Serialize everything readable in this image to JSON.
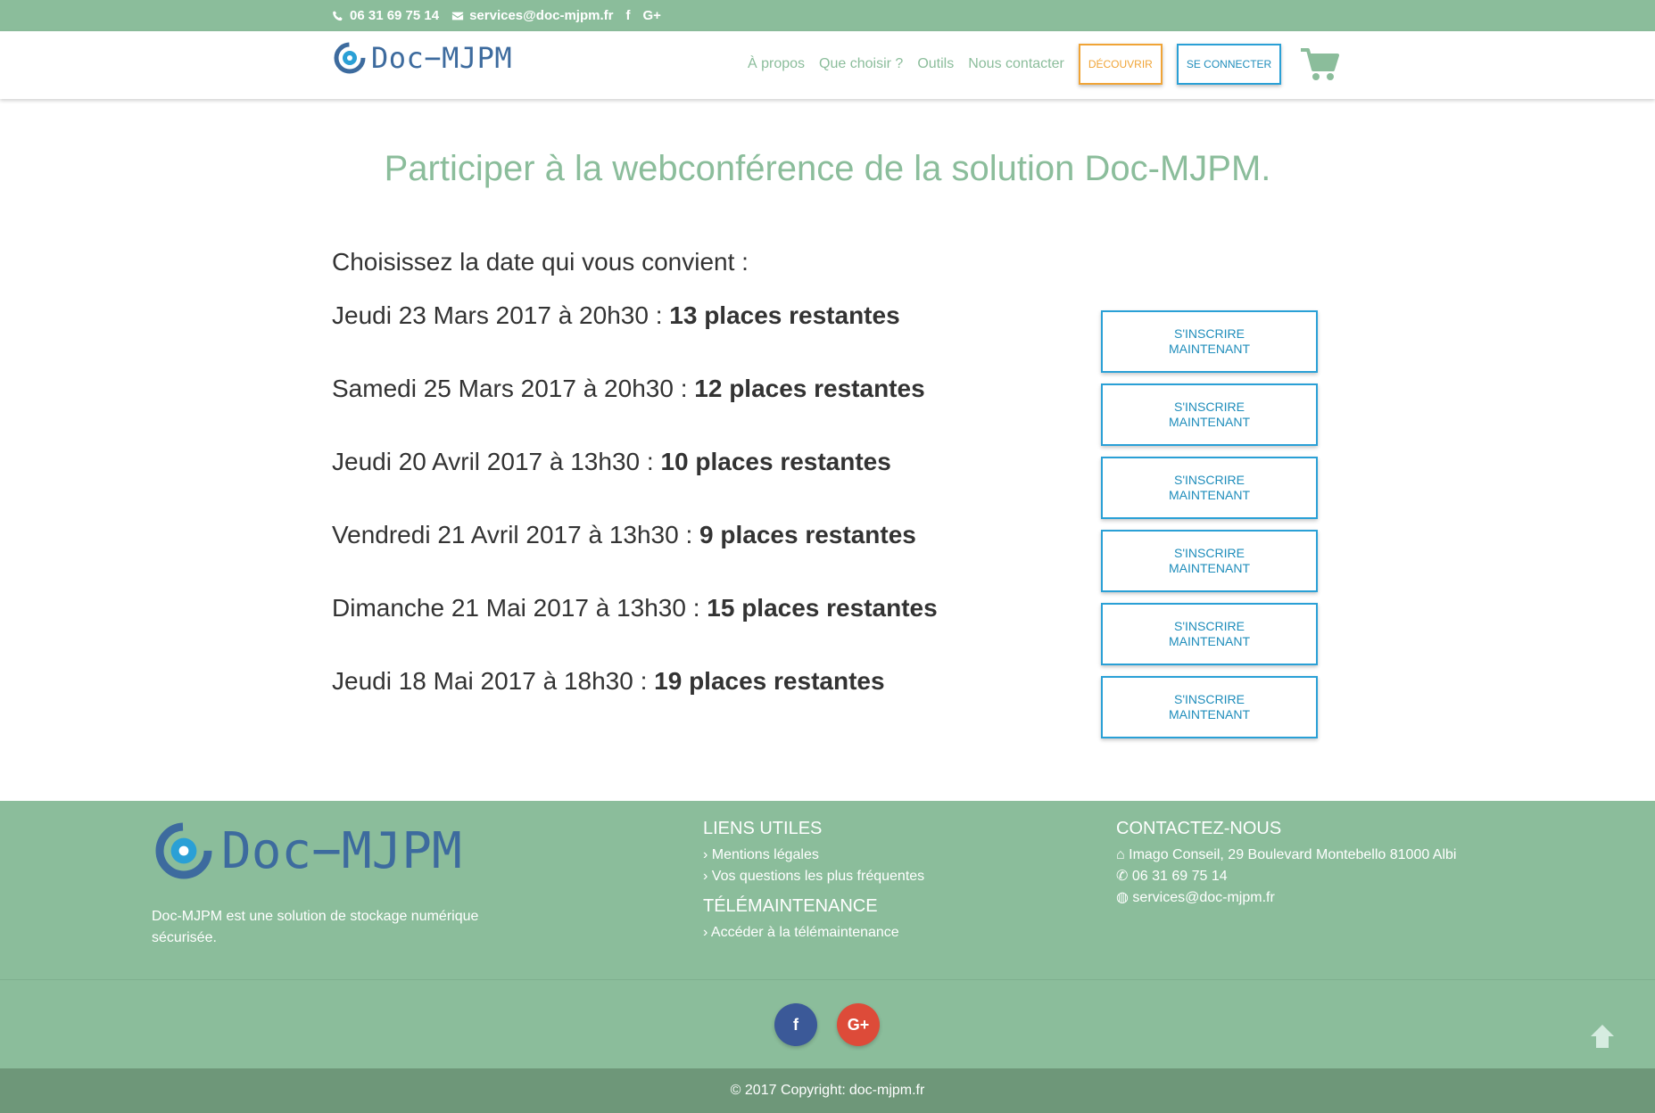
{
  "topbar": {
    "phone": "06 31 69 75 14",
    "email": "services@doc-mjpm.fr",
    "facebook_glyph": "f",
    "googleplus_glyph": "G+"
  },
  "header": {
    "logo_text": "Doc−MJPM",
    "nav": [
      {
        "label": "À propos"
      },
      {
        "label": "Que choisir ?"
      },
      {
        "label": "Outils"
      },
      {
        "label": "Nous contacter"
      }
    ],
    "discover_label": "DÉCOUVRIR",
    "connect_label": "SE CONNECTER"
  },
  "main": {
    "title": "Participer à la webconférence de la solution Doc-MJPM.",
    "intro": "Choisissez la date qui vous convient :",
    "sessions": [
      {
        "date": "Jeudi 23 Mars 2017 à 20h30 : ",
        "places": "13 places restantes"
      },
      {
        "date": "Samedi 25 Mars 2017 à 20h30 : ",
        "places": "12 places restantes"
      },
      {
        "date": "Jeudi 20 Avril 2017 à 13h30 : ",
        "places": "10 places restantes"
      },
      {
        "date": "Vendredi 21 Avril 2017 à 13h30 : ",
        "places": "9 places restantes"
      },
      {
        "date": "Dimanche 21 Mai 2017 à 13h30 : ",
        "places": "15 places restantes"
      },
      {
        "date": "Jeudi 18 Mai 2017 à 18h30 : ",
        "places": "19 places restantes"
      }
    ],
    "register_label": "S'INSCRIRE MAINTENANT"
  },
  "footer": {
    "logo_text": "Doc−MJPM",
    "description": "Doc-MJPM est une solution de stockage numérique sécurisée.",
    "links_heading": "LIENS UTILES",
    "links": [
      {
        "label": "Mentions légales"
      },
      {
        "label": "Vos questions les plus fréquentes"
      }
    ],
    "maintenance_heading": "TÉLÉMAINTENANCE",
    "maintenance_link": "Accéder à la télémaintenance",
    "contact_heading": "CONTACTEZ-NOUS",
    "address": "Imago Conseil, 29 Boulevard Montebello 81000 Albi",
    "phone": "06 31 69 75 14",
    "email": "services@doc-mjpm.fr"
  },
  "social": {
    "facebook_glyph": "f",
    "googleplus_glyph": "G+"
  },
  "copyright": {
    "text": "© 2017 Copyright:",
    "link": "doc-mjpm.fr"
  },
  "colors": {
    "brand_green": "#8bbd9b",
    "brand_blue": "#3d6b9e",
    "button_blue": "#2aa0d6",
    "button_orange": "#f0a436"
  }
}
